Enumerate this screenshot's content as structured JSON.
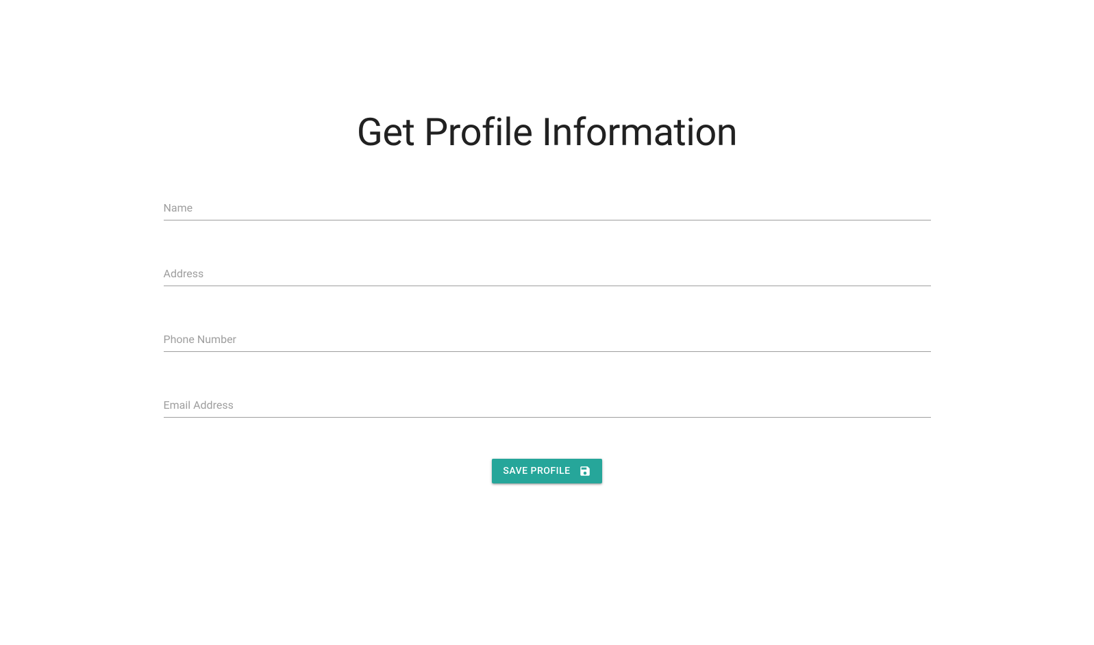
{
  "page": {
    "title": "Get Profile Information"
  },
  "form": {
    "fields": {
      "name": {
        "label": "Name",
        "value": ""
      },
      "address": {
        "label": "Address",
        "value": ""
      },
      "phone": {
        "label": "Phone Number",
        "value": ""
      },
      "email": {
        "label": "Email Address",
        "value": ""
      }
    },
    "save_button_label": "Save Profile"
  }
}
